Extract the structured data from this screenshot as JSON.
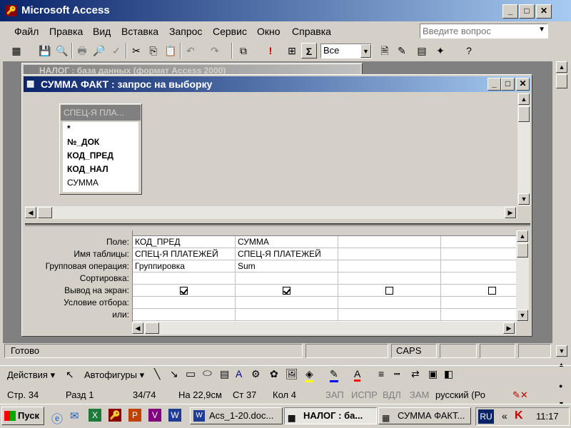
{
  "app": {
    "title": "Microsoft Access"
  },
  "menu": [
    "Файл",
    "Правка",
    "Вид",
    "Вставка",
    "Запрос",
    "Сервис",
    "Окно",
    "Справка"
  ],
  "help_box": {
    "placeholder": "Введите вопрос"
  },
  "toolbar": {
    "top_values": "Все"
  },
  "bg_window": {
    "title": "НАЛОГ : база данных (формат Access 2000)"
  },
  "query_window": {
    "title": "СУММА ФАКТ : запрос на выборку"
  },
  "table_box": {
    "title": "СПЕЦ-Я ПЛА...",
    "fields": [
      "*",
      "№_ДОК",
      "КОД_ПРЕД",
      "КОД_НАЛ",
      "СУММА"
    ]
  },
  "grid": {
    "row_labels": [
      "Поле:",
      "Имя таблицы:",
      "Групповая операция:",
      "Сортировка:",
      "Вывод на экран:",
      "Условие отбора:",
      "или:"
    ],
    "columns": [
      {
        "field": "КОД_ПРЕД",
        "table": "СПЕЦ-Я ПЛАТЕЖЕЙ",
        "group": "Группировка",
        "show": true
      },
      {
        "field": "СУММА",
        "table": "СПЕЦ-Я ПЛАТЕЖЕЙ",
        "group": "Sum",
        "show": true
      },
      {
        "field": "",
        "table": "",
        "group": "",
        "show": false
      },
      {
        "field": "",
        "table": "",
        "group": "",
        "show": false
      }
    ]
  },
  "status": {
    "ready": "Готово",
    "caps": "CAPS"
  },
  "drawing": {
    "actions": "Действия",
    "autoshapes": "Автофигуры"
  },
  "word_status": {
    "page": "Стр. 34",
    "section": "Разд 1",
    "pages": "34/74",
    "at": "На 22,9см",
    "line": "Ст 37",
    "col": "Кол 4",
    "rec": "ЗАП",
    "trk": "ИСПР",
    "ext": "ВДЛ",
    "ovr": "ЗАМ",
    "lang": "русский (Ро"
  },
  "taskbar": {
    "start": "Пуск",
    "buttons": [
      "Acs_1-20.doc...",
      "НАЛОГ : ба...",
      "СУММА ФАКТ..."
    ],
    "lang": "RU",
    "clock": "11:17"
  },
  "colors": {
    "title_active": "#0a246a",
    "face": "#d4d0c8"
  }
}
